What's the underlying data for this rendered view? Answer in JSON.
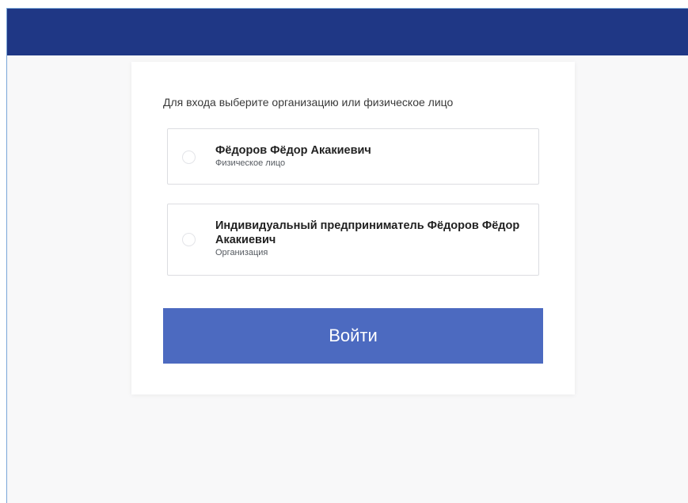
{
  "colors": {
    "topbar": "#1f3785",
    "button": "#4c6ac0",
    "background": "#f8f8f9",
    "card": "#ffffff"
  },
  "login": {
    "prompt": "Для входа выберите организацию или физическое лицо",
    "options": [
      {
        "title": "Фёдоров Фёдор Акакиевич",
        "subtitle": "Физическое лицо",
        "selected": false
      },
      {
        "title": "Индивидуальный предприниматель Фёдоров Фёдор Акакиевич",
        "subtitle": "Организация",
        "selected": false
      }
    ],
    "submit_label": "Войти"
  }
}
